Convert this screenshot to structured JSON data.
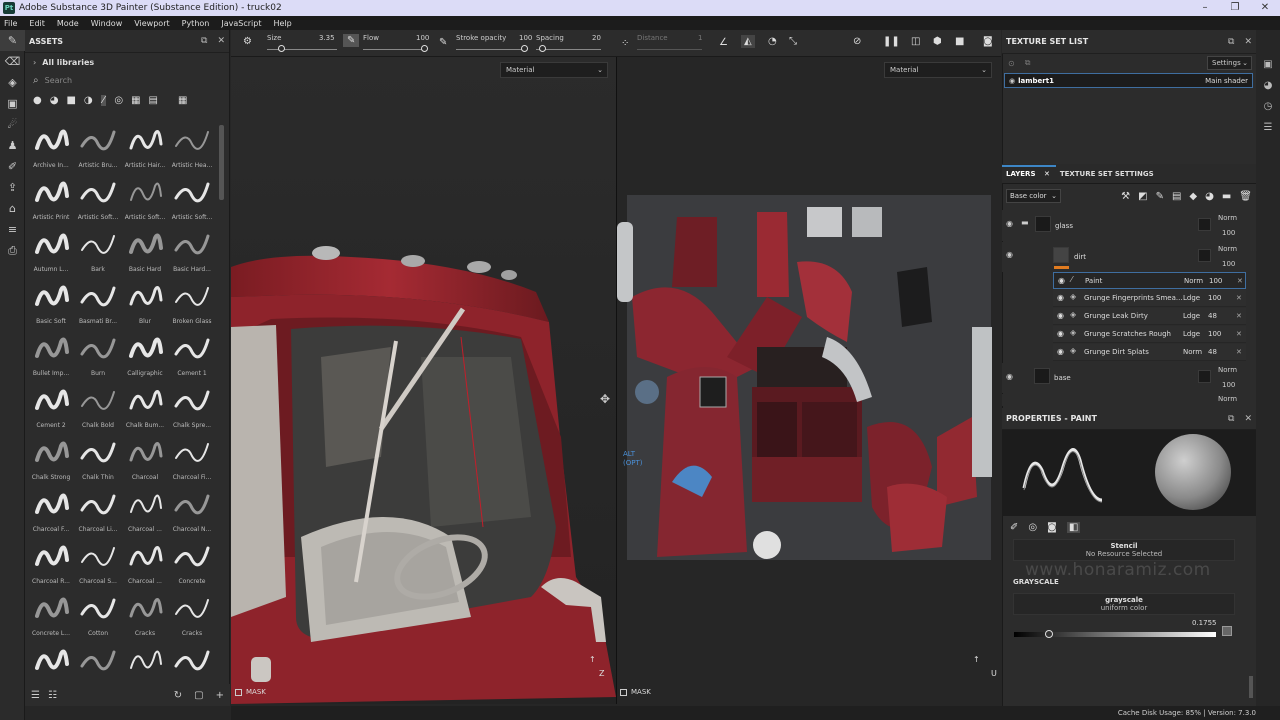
{
  "window": {
    "title": "Adobe Substance 3D Painter (Substance Edition) - truck02",
    "app_icon": "Pt",
    "controls": [
      "–",
      "❐",
      "✕"
    ]
  },
  "menu": [
    "File",
    "Edit",
    "Mode",
    "Window",
    "Viewport",
    "Python",
    "JavaScript",
    "Help"
  ],
  "assets": {
    "title": "ASSETS",
    "library": "All libraries",
    "search_placeholder": "Search",
    "items": [
      "Archive In...",
      "Artistic Bru...",
      "Artistic Hair...",
      "Artistic Hea...",
      "Artistic Print",
      "Artistic Soft...",
      "Artistic Soft...",
      "Artistic Soft...",
      "Autumn L...",
      "Bark",
      "Basic Hard",
      "Basic Hard...",
      "Basic Soft",
      "Basmati Br...",
      "Blur",
      "Broken Glass",
      "Bullet Imp...",
      "Burn",
      "Calligraphic",
      "Cement 1",
      "Cement 2",
      "Chalk Bold",
      "Chalk Bum...",
      "Chalk Spre...",
      "Chalk Strong",
      "Chalk Thin",
      "Charcoal",
      "Charcoal Fi...",
      "Charcoal F...",
      "Charcoal Li...",
      "Charcoal ...",
      "Charcoal N...",
      "Charcoal R...",
      "Charcoal S...",
      "Charcoal ...",
      "Concrete",
      "Concrete L...",
      "Cotton",
      "Cracks",
      "Cracks",
      "",
      "",
      "",
      ""
    ]
  },
  "tool_options": {
    "size_label": "Size",
    "size_value": "3.35",
    "flow_label": "Flow",
    "flow_value": "100",
    "stroke_label": "Stroke opacity",
    "stroke_value": "100",
    "spacing_label": "Spacing",
    "spacing_value": "20",
    "distance_label": "Distance",
    "distance_value": "1"
  },
  "viewport": {
    "left_mode": "Material",
    "right_mode": "Material",
    "mask_label": "MASK",
    "alt_hint": "ALT\n(OPT)",
    "axis_left": "Z",
    "axis_right": "U"
  },
  "texture_set_list": {
    "title": "TEXTURE SET LIST",
    "settings": "Settings",
    "row_name": "lambert1",
    "row_shader": "Main shader"
  },
  "layers": {
    "tabs": [
      "LAYERS",
      "TEXTURE SET SETTINGS"
    ],
    "channel": "Base color",
    "groups": [
      {
        "name": "glass",
        "blend": "Norm",
        "opacity": "100"
      },
      {
        "name": "dirt",
        "blend": "Norm",
        "opacity": "100"
      },
      {
        "name": "base",
        "blend": "Norm",
        "opacity": "100"
      }
    ],
    "sublayers": [
      {
        "name": "Paint",
        "blend": "Norm",
        "opacity": "100"
      },
      {
        "name": "Grunge Fingerprints Smea...",
        "blend": "Ldge",
        "opacity": "100"
      },
      {
        "name": "Grunge Leak Dirty",
        "blend": "Ldge",
        "opacity": "48"
      },
      {
        "name": "Grunge Scratches Rough",
        "blend": "Ldge",
        "opacity": "100"
      },
      {
        "name": "Grunge Dirt Splats",
        "blend": "Norm",
        "opacity": "48"
      }
    ],
    "partial_row": {
      "blend": "Norm",
      "opacity": "100"
    }
  },
  "properties": {
    "title": "PROPERTIES - PAINT",
    "stencil_title": "Stencil",
    "stencil_sub": "No Resource Selected",
    "grayscale_section": "GRAYSCALE",
    "grayscale_title": "grayscale",
    "grayscale_sub": "uniform color",
    "grayscale_value": "0.1755",
    "grayscale_level": 0.1755
  },
  "status": {
    "text": "Cache Disk Usage:  85% | Version: 7.3.0"
  },
  "watermark": "www.honaramiz.com",
  "colors": {
    "accent": "#3d86c6",
    "truck_red": "#9e2630",
    "panel_bg": "#2c2c2c"
  }
}
